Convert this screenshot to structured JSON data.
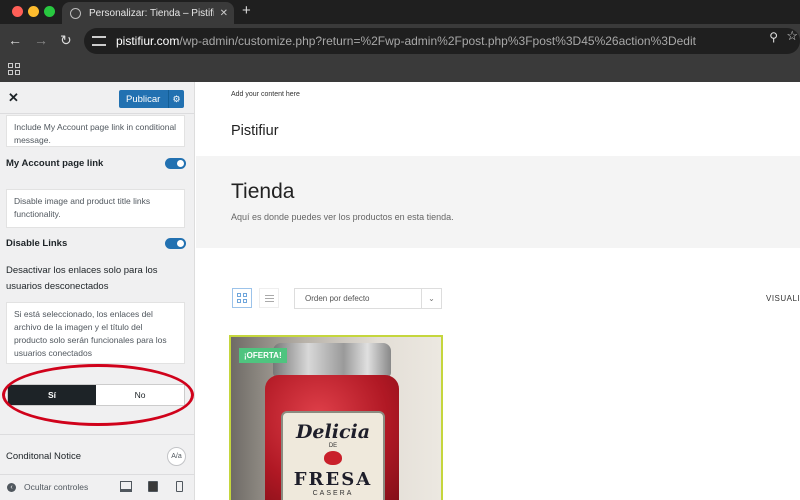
{
  "browser": {
    "tab_title": "Personalizar: Tienda – Pistifiur",
    "tab_close": "✕",
    "new_tab": "+",
    "url_host": "pistifiur.com",
    "url_path": "/wp-admin/customize.php?return=%2Fwp-admin%2Fpost.php%3Fpost%3D45%26action%3Dedit",
    "icons": [
      "back-icon",
      "forward-icon",
      "reload-icon",
      "tune-icon",
      "zoom-icon",
      "star-icon",
      "apps-icon"
    ]
  },
  "sidebar": {
    "publish_label": "Publicar",
    "desc_account": "Include My Account page link in conditional message.",
    "account_link_label": "My Account page link",
    "desc_disable": "Disable image and product title links functionality.",
    "disable_links_label": "Disable Links",
    "guest_title": "Desactivar los enlaces solo para los usuarios desconectados",
    "guest_desc": "Si está seleccionado, los enlaces del archivo de la imagen y el título del producto solo serán funcionales para los usuarios conectados",
    "seg_yes": "Sí",
    "seg_no": "No",
    "notice_label": "Conditonal Notice",
    "aa_label": "A/a",
    "hide_controls": "Ocultar controles",
    "toggles": {
      "account_link": true,
      "disable_links": true
    },
    "selected": "Sí"
  },
  "preview": {
    "top_note": "Add your content here",
    "site_title": "Pistifiur",
    "page_title": "Tienda",
    "page_desc": "Aquí es donde puedes ver los productos en esta tienda.",
    "sort_default": "Orden por defecto",
    "visual_label": "VISUALI",
    "sale_badge": "¡OFERTA!",
    "product_label": {
      "line1": "Delicia",
      "line2": "DE",
      "line3": "FRESA",
      "line4": "CASERA"
    }
  },
  "colors": {
    "accent": "#2271b1",
    "annotation_circle": "#d0021b",
    "sale_badge": "#4fc47f",
    "card_border": "#c5d63d"
  }
}
